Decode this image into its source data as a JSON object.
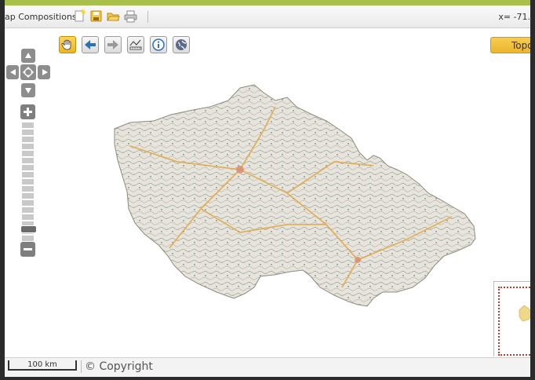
{
  "toolbar": {
    "map_compositions_label": "ap Compositions:",
    "icons": [
      "new-composition-icon",
      "save-icon",
      "open-folder-icon",
      "print-icon"
    ],
    "coordinates": "x= -71."
  },
  "map_toolbar": {
    "tools": [
      "pan-hand-icon",
      "back-arrow-icon",
      "forward-arrow-icon",
      "measure-icon",
      "info-icon",
      "globe-icon"
    ],
    "active_tool": "pan-hand-icon",
    "layer_button_label": "Topo",
    "layer_button_color": "#f0bb2e"
  },
  "navigation": {
    "pan": [
      "pan-up-icon",
      "pan-left-icon",
      "pan-center-icon",
      "pan-right-icon",
      "pan-down-icon"
    ],
    "zoom_levels": 19,
    "zoom_level_selected": 18
  },
  "status": {
    "scale_label": "100 km",
    "copyright": "© Copyright"
  },
  "colors": {
    "accent_green": "#a9c04a",
    "overview_box": "#c0392b"
  }
}
